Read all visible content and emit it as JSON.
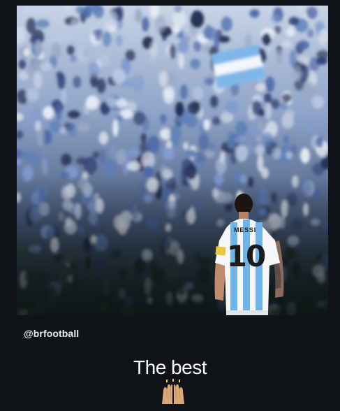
{
  "post": {
    "photo": {
      "alt": "",
      "jersey_name": "MESSI",
      "jersey_number": "10"
    },
    "credit": "@brfootball",
    "caption": "The best",
    "caption_emoji": "raised-hands-emoji"
  },
  "colors": {
    "background": "#101317",
    "jersey_blue": "#6fb4e6",
    "jersey_white": "#f4f6f8",
    "crowd_blue": "#5d7fb8"
  }
}
